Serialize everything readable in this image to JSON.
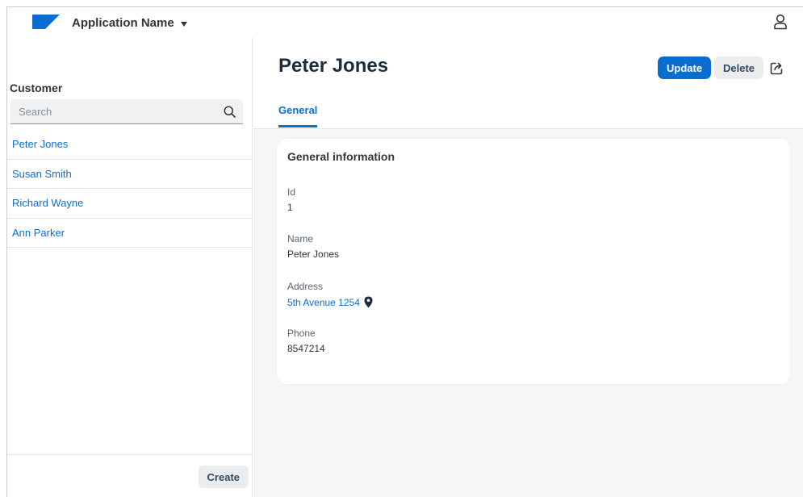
{
  "shell": {
    "app_name": "Application Name",
    "brand_color": "#0a6ed1",
    "icons": [
      "logo",
      "chevron-down-icon",
      "user-icon"
    ]
  },
  "master": {
    "title": "Customer",
    "search": {
      "placeholder": "Search",
      "value": ""
    },
    "items": [
      {
        "label": "Peter Jones"
      },
      {
        "label": "Susan Smith"
      },
      {
        "label": "Richard Wayne"
      },
      {
        "label": "Ann Parker"
      }
    ],
    "create_label": "Create"
  },
  "detail": {
    "title": "Peter Jones",
    "update_label": "Update",
    "delete_label": "Delete",
    "tabs": [
      {
        "label": "General",
        "selected": true
      }
    ],
    "card": {
      "title": "General information",
      "fields": {
        "id": {
          "label": "Id",
          "value": "1"
        },
        "name": {
          "label": "Name",
          "value": "Peter Jones"
        },
        "address": {
          "label": "Address",
          "value": "5th Avenue 1254"
        },
        "phone": {
          "label": "Phone",
          "value": "8547214"
        }
      }
    }
  }
}
